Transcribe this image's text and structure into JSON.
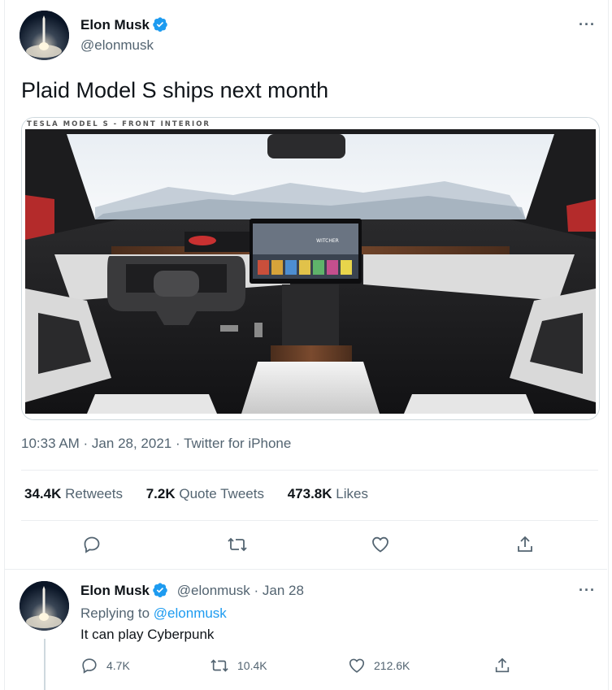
{
  "tweet": {
    "author_name": "Elon Musk",
    "author_handle": "@elonmusk",
    "text": "Plaid Model S ships next month",
    "media_caption": "TESLA MODEL S - FRONT INTERIOR",
    "screen_game_title": "WITCHER",
    "timestamp": "10:33 AM · Jan 28, 2021",
    "source": "Twitter for iPhone",
    "retweets_count": "34.4K",
    "retweets_label": "Retweets",
    "quote_count": "7.2K",
    "quote_label": "Quote Tweets",
    "likes_count": "473.8K",
    "likes_label": "Likes",
    "more": "···"
  },
  "reply": {
    "author_name": "Elon Musk",
    "author_handle": "@elonmusk",
    "date": "Jan 28",
    "replying_prefix": "Replying to",
    "replying_to": "@elonmusk",
    "text": "It can play Cyberpunk",
    "reply_count": "4.7K",
    "retweet_count": "10.4K",
    "like_count": "212.6K",
    "more": "···"
  },
  "colors": {
    "accent": "#1d9bf0",
    "secondary_text": "#536471",
    "divider": "#ebeef0"
  },
  "icons": {
    "reply": "reply-icon",
    "retweet": "retweet-icon",
    "like": "heart-icon",
    "share": "share-icon",
    "verified": "verified-badge-icon"
  }
}
